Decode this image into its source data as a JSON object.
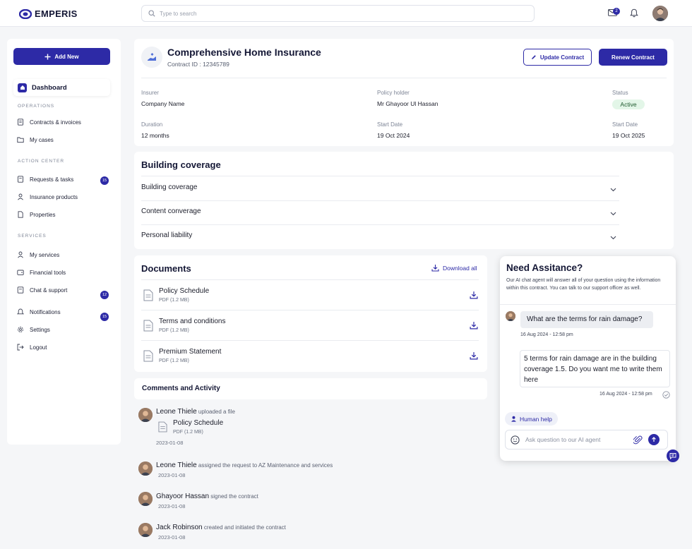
{
  "brand": {
    "name": "EMPERIS",
    "accent": "#2d2aa6"
  },
  "header": {
    "search_placeholder": "Type to search",
    "mail_count": "2"
  },
  "sidebar": {
    "add_new": "Add New",
    "dashboard": "Dashboard",
    "sections": [
      {
        "title": "OPERATIONS",
        "items": [
          {
            "label": "Contracts & invoices",
            "icon": "contract-icon"
          },
          {
            "label": "My cases",
            "icon": "folder-icon"
          }
        ]
      },
      {
        "title": "ACTION CENTER",
        "items": [
          {
            "label": "Requests & tasks",
            "icon": "tasks-icon",
            "badge": "15"
          },
          {
            "label": "Insurance products",
            "icon": "user-icon"
          },
          {
            "label": "Properties",
            "icon": "doc-icon"
          }
        ]
      },
      {
        "title": "SERVICES",
        "items": [
          {
            "label": "My services",
            "icon": "user-icon"
          },
          {
            "label": "Financial tools",
            "icon": "wallet-icon"
          },
          {
            "label": "Chat & support",
            "icon": "chat-icon",
            "badge": "12"
          },
          {
            "label": "Notifications",
            "icon": "bell-icon",
            "badge": "15"
          },
          {
            "label": "Settings",
            "icon": "gear-icon"
          },
          {
            "label": "Logout",
            "icon": "logout-icon"
          }
        ]
      }
    ]
  },
  "contract": {
    "title": "Comprehensive Home Insurance",
    "contract_id": "Contract ID : 12345789",
    "update_btn": "Update Contract",
    "renew_btn": "Renew Contract",
    "fields": [
      {
        "label": "Insurer",
        "value": "Company Name"
      },
      {
        "label": "Policy holder",
        "value": "Mr Ghayoor Ul Hassan"
      },
      {
        "label": "Status",
        "value": "Active"
      },
      {
        "label": "Duration",
        "value": "12 months"
      },
      {
        "label": "Start Date",
        "value": "19 Oct 2024"
      },
      {
        "label": "Start Date",
        "value": "19 Oct 2025"
      }
    ]
  },
  "coverage": {
    "title": "Building coverage",
    "rows": [
      "Building coverage",
      "Content converage",
      "Personal liability"
    ]
  },
  "documents": {
    "title": "Documents",
    "download_all": "Download all",
    "items": [
      {
        "name": "Policy Schedule",
        "meta": "PDF (1.2 MB)"
      },
      {
        "name": "Terms and conditions",
        "meta": "PDF (1.2 MB)"
      },
      {
        "name": "Premium Statement",
        "meta": "PDF (1.2 MB)"
      }
    ]
  },
  "activity": {
    "title": "Comments and Activity",
    "items": [
      {
        "user": "Leone Thiele",
        "action": "uploaded a file",
        "date": "2023-01-08",
        "file_name": "Policy Schedule",
        "file_meta": "PDF (1.2 MB)"
      },
      {
        "user": "Leone Thiele",
        "action": "assigned the request to AZ Maintenance and services",
        "date": "2023-01-08"
      },
      {
        "user": "Ghayoor Hassan",
        "action": "signed the contract",
        "date": "2023-01-08"
      },
      {
        "user": "Jack Robinson",
        "action": "created and initiated the contract",
        "date": "2023-01-08"
      }
    ]
  },
  "chat": {
    "title": "Need Assitance?",
    "description": "Our AI chat agent will answer all of your question using the information within this contract. You can talk to our support officer as well.",
    "question": "What are the terms for rain damage?",
    "question_time": "16 Aug 2024 - 12:58 pm",
    "answer": "5 terms for rain damage are in the building coverage 1.5. Do you want me to write them here",
    "answer_time": "16 Aug 2024 - 12:58 pm",
    "human_help": "Human help",
    "input_placeholder": "Ask question to our AI agent"
  }
}
